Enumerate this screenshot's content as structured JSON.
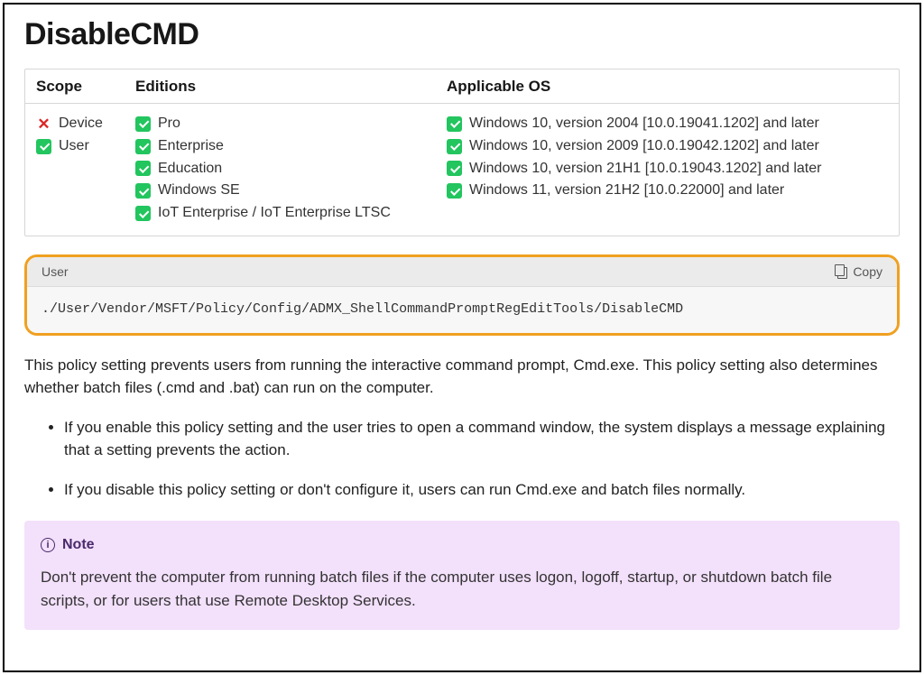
{
  "title": "DisableCMD",
  "table": {
    "headers": {
      "scope": "Scope",
      "editions": "Editions",
      "os": "Applicable OS"
    },
    "scope": [
      {
        "icon": "x",
        "label": "Device"
      },
      {
        "icon": "check",
        "label": "User"
      }
    ],
    "editions": [
      {
        "icon": "check",
        "label": "Pro"
      },
      {
        "icon": "check",
        "label": "Enterprise"
      },
      {
        "icon": "check",
        "label": "Education"
      },
      {
        "icon": "check",
        "label": "Windows SE"
      },
      {
        "icon": "check",
        "label": "IoT Enterprise / IoT Enterprise LTSC"
      }
    ],
    "os": [
      {
        "icon": "check",
        "label": "Windows 10, version 2004 [10.0.19041.1202] and later"
      },
      {
        "icon": "check",
        "label": "Windows 10, version 2009 [10.0.19042.1202] and later"
      },
      {
        "icon": "check",
        "label": "Windows 10, version 21H1 [10.0.19043.1202] and later"
      },
      {
        "icon": "check",
        "label": "Windows 11, version 21H2 [10.0.22000] and later"
      }
    ]
  },
  "code": {
    "label": "User",
    "copy": "Copy",
    "path": "./User/Vendor/MSFT/Policy/Config/ADMX_ShellCommandPromptRegEditTools/DisableCMD"
  },
  "description": "This policy setting prevents users from running the interactive command prompt, Cmd.exe. This policy setting also determines whether batch files (.cmd and .bat) can run on the computer.",
  "bullets": [
    "If you enable this policy setting and the user tries to open a command window, the system displays a message explaining that a setting prevents the action.",
    "If you disable this policy setting or don't configure it, users can run Cmd.exe and batch files normally."
  ],
  "note": {
    "title": "Note",
    "body": "Don't prevent the computer from running batch files if the computer uses logon, logoff, startup, or shutdown batch file scripts, or for users that use Remote Desktop Services."
  }
}
